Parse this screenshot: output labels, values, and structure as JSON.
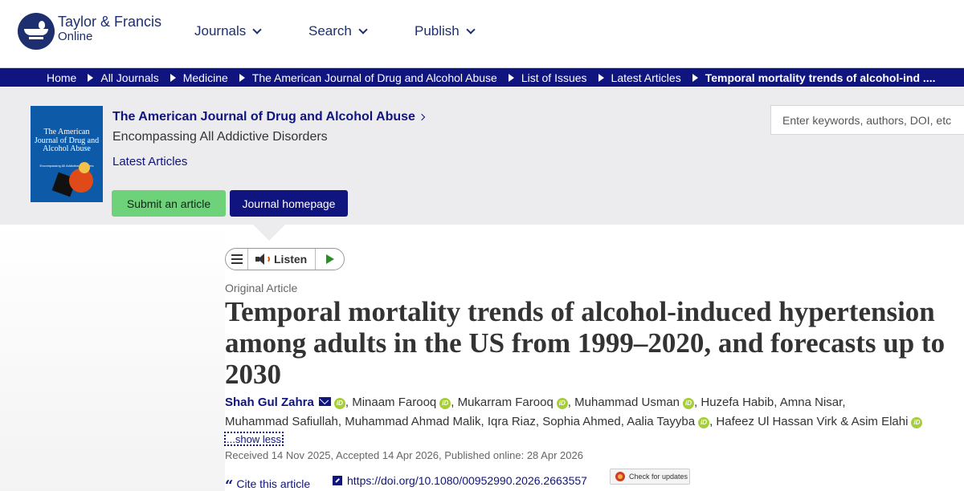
{
  "header": {
    "logo": {
      "line1": "Taylor & Francis",
      "line2": "Online"
    },
    "nav": [
      {
        "label": "Journals",
        "icon": "chevron-down-icon"
      },
      {
        "label": "Search",
        "icon": "chevron-down-icon"
      },
      {
        "label": "Publish",
        "icon": "chevron-down-icon"
      }
    ]
  },
  "breadcrumb": [
    "Home",
    "All Journals",
    "Medicine",
    "The American Journal of Drug and Alcohol Abuse",
    "List of Issues",
    "Latest Articles",
    "Temporal mortality trends of alcohol-ind ...."
  ],
  "journal": {
    "cover": {
      "title": "The American Journal of Drug and Alcohol Abuse",
      "subtitle": "Encompassing All Addictive Disorders"
    },
    "title": "The American Journal of Drug and Alcohol Abuse",
    "subtitle": "Encompassing All Addictive Disorders",
    "latest_link": "Latest Articles",
    "submit_label": "Submit an article",
    "homepage_label": "Journal homepage",
    "search_placeholder": "Enter keywords, authors, DOI, etc"
  },
  "listen_bar": {
    "listen_label": "Listen"
  },
  "article": {
    "type": "Original Article",
    "title": "Temporal mortality trends of alcohol-induced hypertension among adults in the US from 1999–2020, and forecasts up to 2030",
    "authors": [
      "Shah Gul Zahra",
      "Minaam Farooq",
      "Mukarram Farooq",
      "Muhammad Usman",
      "Huzefa Habib",
      "Amna Nisar",
      "Muhammad Safiullah",
      "Muhammad Ahmad Malik",
      "Iqra Riaz",
      "Sophia Ahmed",
      "Aalia Tayyba",
      "Hafeez Ul Hassan Virk",
      "Asim Elahi"
    ],
    "show_less": "...show less",
    "dates": "Received 14 Nov 2025, Accepted 14 Apr 2026, Published online: 28 Apr 2026",
    "cite_label": "Cite this article",
    "doi": "https://doi.org/10.1080/00952990.2026.2663557",
    "check_updates": "Check for updates"
  },
  "colors": {
    "brand": "#10147e",
    "submit_button": "#6ed27a",
    "band_background": "#ececee",
    "orcid": "#a6ce39"
  }
}
